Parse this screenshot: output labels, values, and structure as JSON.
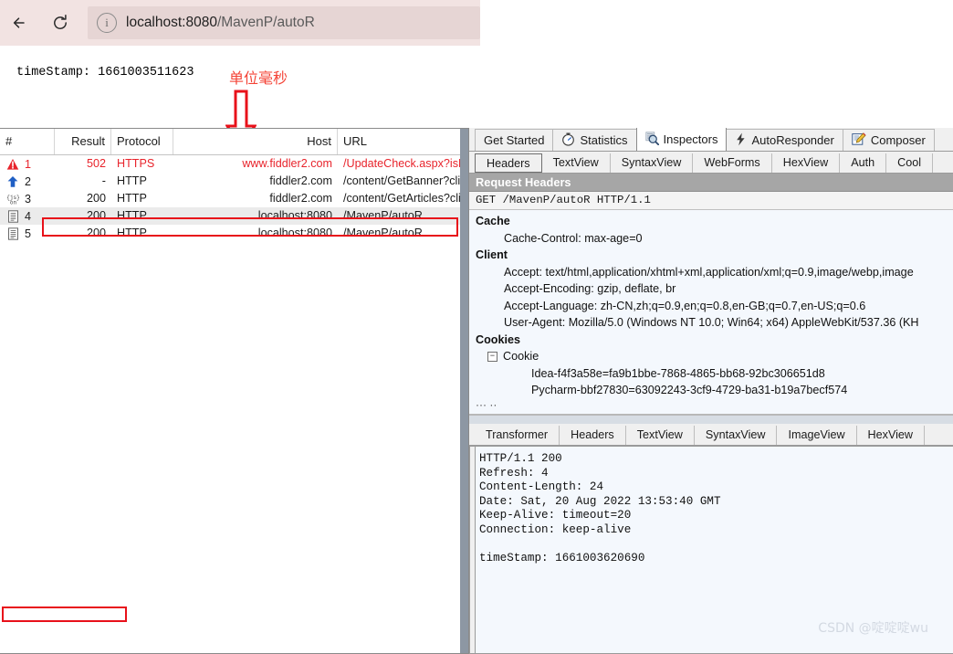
{
  "browser": {
    "back_label": "←",
    "reload_label": "↻",
    "info_icon": "info-circle-icon",
    "url_host": "localhost:8080",
    "url_path": "/MavenP/autoR"
  },
  "page": {
    "servlet_output": "timeStamp: 1661003511623"
  },
  "annotation": {
    "label": "单位毫秒",
    "arrow_icon": "down-arrow-outline-icon",
    "color": "#f44336"
  },
  "fiddler": {
    "sessions": {
      "columns": [
        "#",
        "Result",
        "Protocol",
        "Host",
        "URL"
      ],
      "rows": [
        {
          "icon": "warning-triangle-icon",
          "num": "1",
          "result": "502",
          "protocol": "HTTPS",
          "host": "www.fiddler2.com",
          "url": "/UpdateCheck.aspx?isBet",
          "error": true,
          "selected": false
        },
        {
          "icon": "blue-up-arrow-icon",
          "num": "2",
          "result": "-",
          "protocol": "HTTP",
          "host": "fiddler2.com",
          "url": "/content/GetBanner?clien",
          "error": false,
          "selected": false
        },
        {
          "icon": "json-icon",
          "num": "3",
          "result": "200",
          "protocol": "HTTP",
          "host": "fiddler2.com",
          "url": "/content/GetArticles?clien",
          "error": false,
          "selected": false
        },
        {
          "icon": "document-icon",
          "num": "4",
          "result": "200",
          "protocol": "HTTP",
          "host": "localhost:8080",
          "url": "/MavenP/autoR",
          "error": false,
          "selected": true
        },
        {
          "icon": "document-icon",
          "num": "5",
          "result": "200",
          "protocol": "HTTP",
          "host": "localhost:8080",
          "url": "/MavenP/autoR",
          "error": false,
          "selected": false
        }
      ],
      "highlight_color": "#e8111a"
    },
    "main_tabs": [
      {
        "label": "Get Started",
        "icon": "",
        "active": false
      },
      {
        "label": "Statistics",
        "icon": "stopwatch-icon",
        "active": false
      },
      {
        "label": "Inspectors",
        "icon": "magnifier-icon",
        "active": true
      },
      {
        "label": "AutoResponder",
        "icon": "lightning-icon",
        "active": false
      },
      {
        "label": "Composer",
        "icon": "pencil-note-icon",
        "active": false
      }
    ],
    "request_tabs": [
      {
        "label": "Headers",
        "active": true
      },
      {
        "label": "TextView",
        "active": false
      },
      {
        "label": "SyntaxView",
        "active": false
      },
      {
        "label": "WebForms",
        "active": false
      },
      {
        "label": "HexView",
        "active": false
      },
      {
        "label": "Auth",
        "active": false
      },
      {
        "label": "Cool",
        "active": false
      }
    ],
    "request": {
      "banner": "Request Headers",
      "request_line": "GET /MavenP/autoR HTTP/1.1",
      "groups": [
        {
          "name": "Cache",
          "items": [
            "Cache-Control: max-age=0"
          ]
        },
        {
          "name": "Client",
          "items": [
            "Accept: text/html,application/xhtml+xml,application/xml;q=0.9,image/webp,image",
            "Accept-Encoding: gzip, deflate, br",
            "Accept-Language: zh-CN,zh;q=0.9,en;q=0.8,en-GB;q=0.7,en-US;q=0.6",
            "User-Agent: Mozilla/5.0 (Windows NT 10.0; Win64; x64) AppleWebKit/537.36 (KH"
          ]
        }
      ],
      "cookies_group": "Cookies",
      "cookie_node": "Cookie",
      "cookie_expander": "−",
      "cookie_values": [
        "Idea-f4f3a58e=fa9b1bbe-7868-4865-bb68-92bc306651d8",
        "Pycharm-bbf27830=63092243-3cf9-4729-ba31-b19a7becf574"
      ],
      "truncated_marker": "···    ··"
    },
    "response_tabs": [
      {
        "label": "Transformer",
        "active": false
      },
      {
        "label": "Headers",
        "active": false
      },
      {
        "label": "TextView",
        "active": false
      },
      {
        "label": "SyntaxView",
        "active": false
      },
      {
        "label": "ImageView",
        "active": false
      },
      {
        "label": "HexView",
        "active": false
      }
    ],
    "response": {
      "text": "HTTP/1.1 200\nRefresh: 4\nContent-Length: 24\nDate: Sat, 20 Aug 2022 13:53:40 GMT\nKeep-Alive: timeout=20\nConnection: keep-alive\n\ntimeStamp: 1661003620690",
      "highlight_color": "#e8111a"
    },
    "watermark": "CSDN @啶啶啶wu"
  }
}
